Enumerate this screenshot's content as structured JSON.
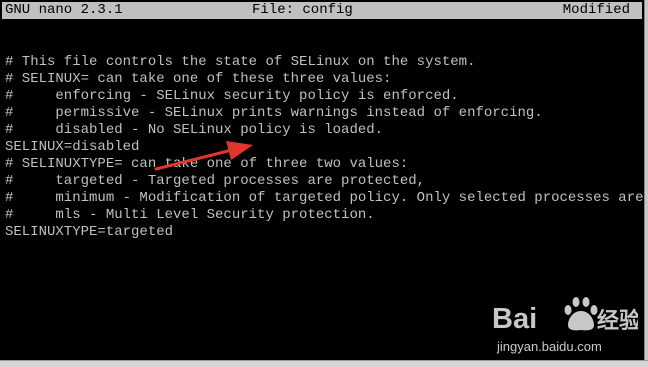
{
  "titlebar": {
    "app": "GNU nano 2.3.1",
    "file": "File: config",
    "status": "Modified"
  },
  "editor": {
    "lines": [
      "# This file controls the state of SELinux on the system.",
      "# SELINUX= can take one of these three values:",
      "#     enforcing - SELinux security policy is enforced.",
      "#     permissive - SELinux prints warnings instead of enforcing.",
      "#     disabled - No SELinux policy is loaded.",
      "SELINUX=disabled",
      "# SELINUXTYPE= can take one of three two values:",
      "#     targeted - Targeted processes are protected,",
      "#     minimum - Modification of targeted policy. Only selected processes are pr$",
      "#     mls - Multi Level Security protection.",
      "SELINUXTYPE=targeted"
    ]
  },
  "annotation": {
    "arrow_color": "#e0362b"
  },
  "watermark": {
    "brand": "Bai",
    "brand_suffix": "经验",
    "site": "jingyan.baidu.com"
  }
}
